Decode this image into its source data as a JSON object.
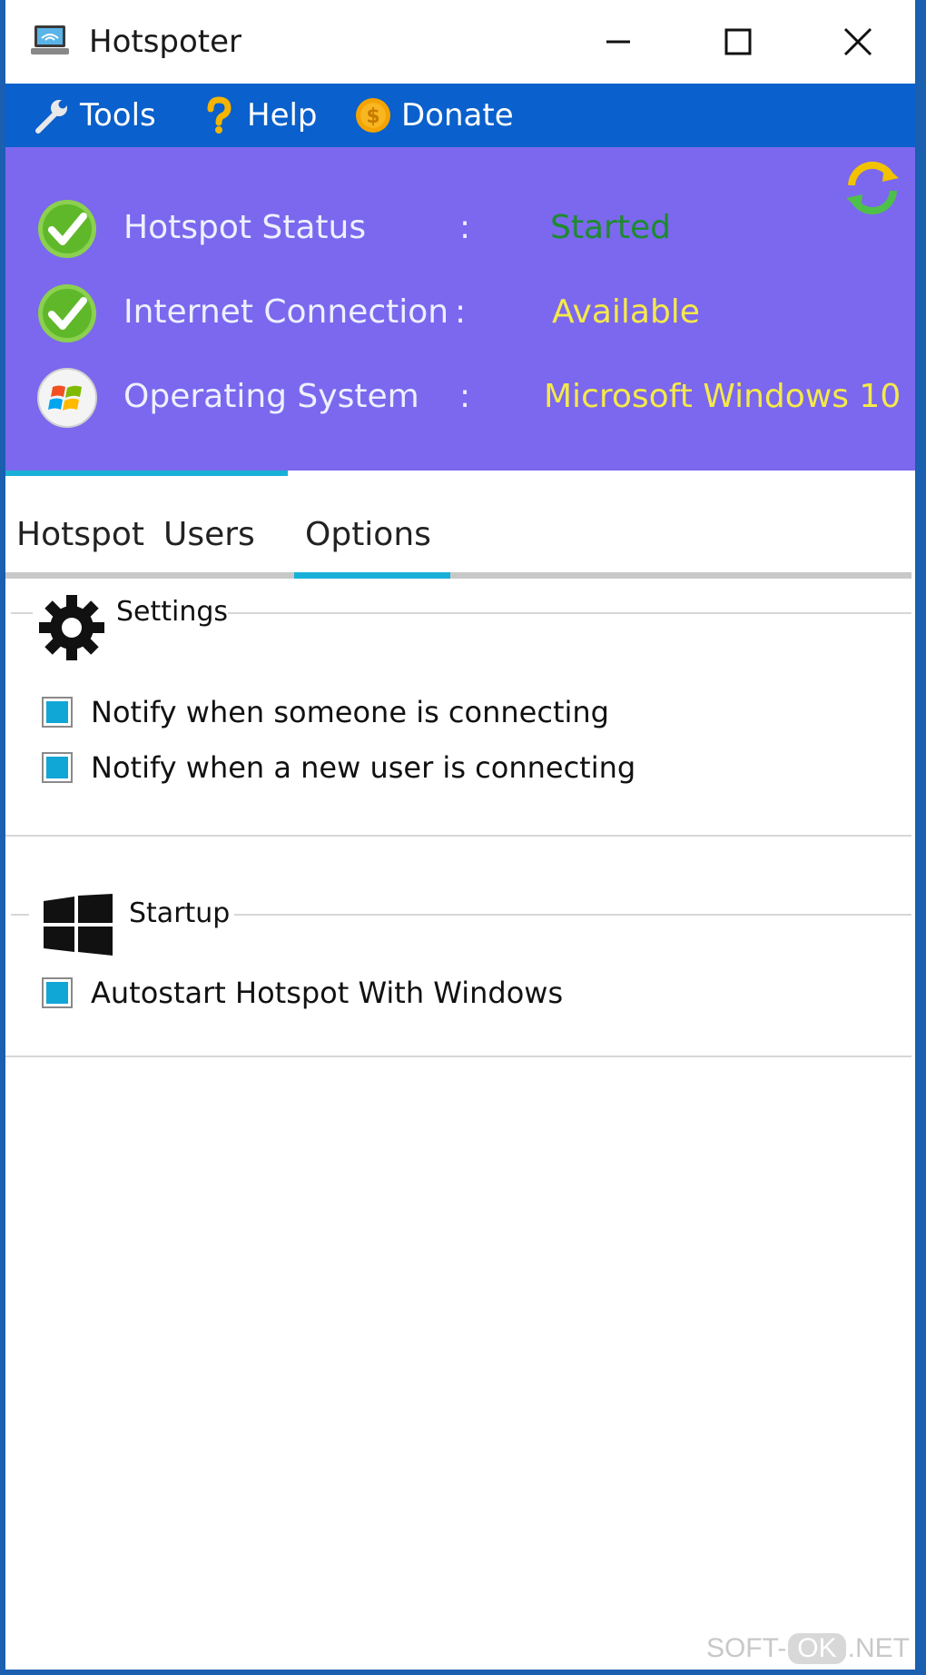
{
  "window": {
    "title": "Hotspoter"
  },
  "menu": {
    "tools": "Tools",
    "help": "Help",
    "donate": "Donate"
  },
  "status": {
    "rows": [
      {
        "label": "Hotspot Status",
        "colon": ":",
        "value": "Started",
        "icon": "check-icon"
      },
      {
        "label": "Internet Connection",
        "colon": ":",
        "value": "Available",
        "icon": "check-icon"
      },
      {
        "label": "Operating System",
        "colon": ":",
        "value": "Microsoft Windows 10",
        "icon": "windows-logo-icon"
      }
    ],
    "value_colors": {
      "started": "#1e8a2e",
      "available": "#f5e94a",
      "os": "#f5e94a"
    },
    "panel_color": "#7b68ee",
    "progress_fraction": 0.31
  },
  "tabs": [
    {
      "label": "Hotspot"
    },
    {
      "label": "Users"
    },
    {
      "label": "Options",
      "selected": true
    }
  ],
  "settings": {
    "title": "Settings",
    "options": [
      {
        "label": "Notify when someone is connecting",
        "checked": true
      },
      {
        "label": "Notify when a new user is connecting",
        "checked": true
      }
    ]
  },
  "startup": {
    "title": "Startup",
    "options": [
      {
        "label": "Autostart Hotspot With Windows",
        "checked": true
      }
    ]
  },
  "watermark": {
    "left": "SOFT-",
    "ok": "OK",
    "right": ".NET"
  },
  "colors": {
    "menubar": "#0a60cc",
    "accent": "#19b0d8",
    "checkbox": "#10a6d6"
  }
}
